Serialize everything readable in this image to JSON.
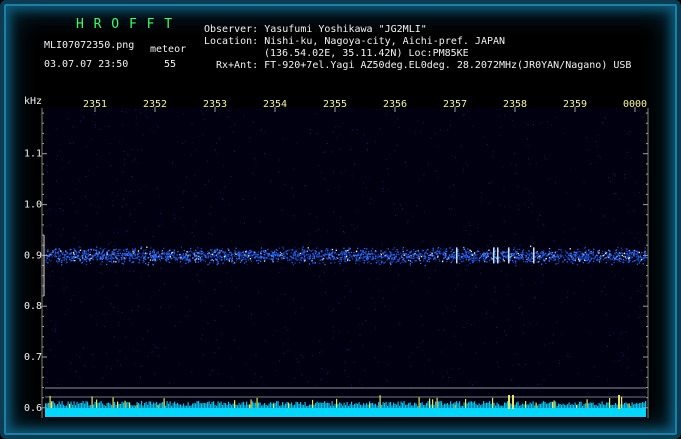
{
  "app": {
    "title": "H R O F F T",
    "filename": "MLI07072350.png",
    "mode_label": "meteor",
    "datetime": "03.07.07 23:50",
    "count": "55"
  },
  "info": {
    "observer": "Observer: Yasufumi Yoshikawa \"JG2MLI\"",
    "location_line1": "Location: Nishi-ku, Nagoya-city, Aichi-pref. JAPAN",
    "location_line2": "(136.54.02E, 35.11.42N) Loc:PM85KE",
    "rx_ant": "Rx+Ant: FT-920+7el.Yagi AZ50deg.EL0deg. 28.2072MHz(JR0YAN/Nagano) USB"
  },
  "chart_data": {
    "type": "heatmap",
    "ylabel": "kHz",
    "ylim": [
      0.58,
      1.19
    ],
    "y_ticks": [
      "1.1",
      "1.0",
      "0.9",
      "0.8",
      "0.7",
      "0.6"
    ],
    "y_tick_values": [
      1.1,
      1.0,
      0.9,
      0.8,
      0.7,
      0.6
    ],
    "x_ticks": [
      "2351",
      "2352",
      "2353",
      "2354",
      "2355",
      "2356",
      "2357",
      "2358",
      "2359",
      "0000"
    ],
    "signal_band_khz": 0.9,
    "colors": {
      "background": "#000010",
      "signal": "#2a6cff",
      "hot": "#ffffff",
      "noise_floor": "#00d8ff",
      "spike": "#e8e860"
    }
  }
}
